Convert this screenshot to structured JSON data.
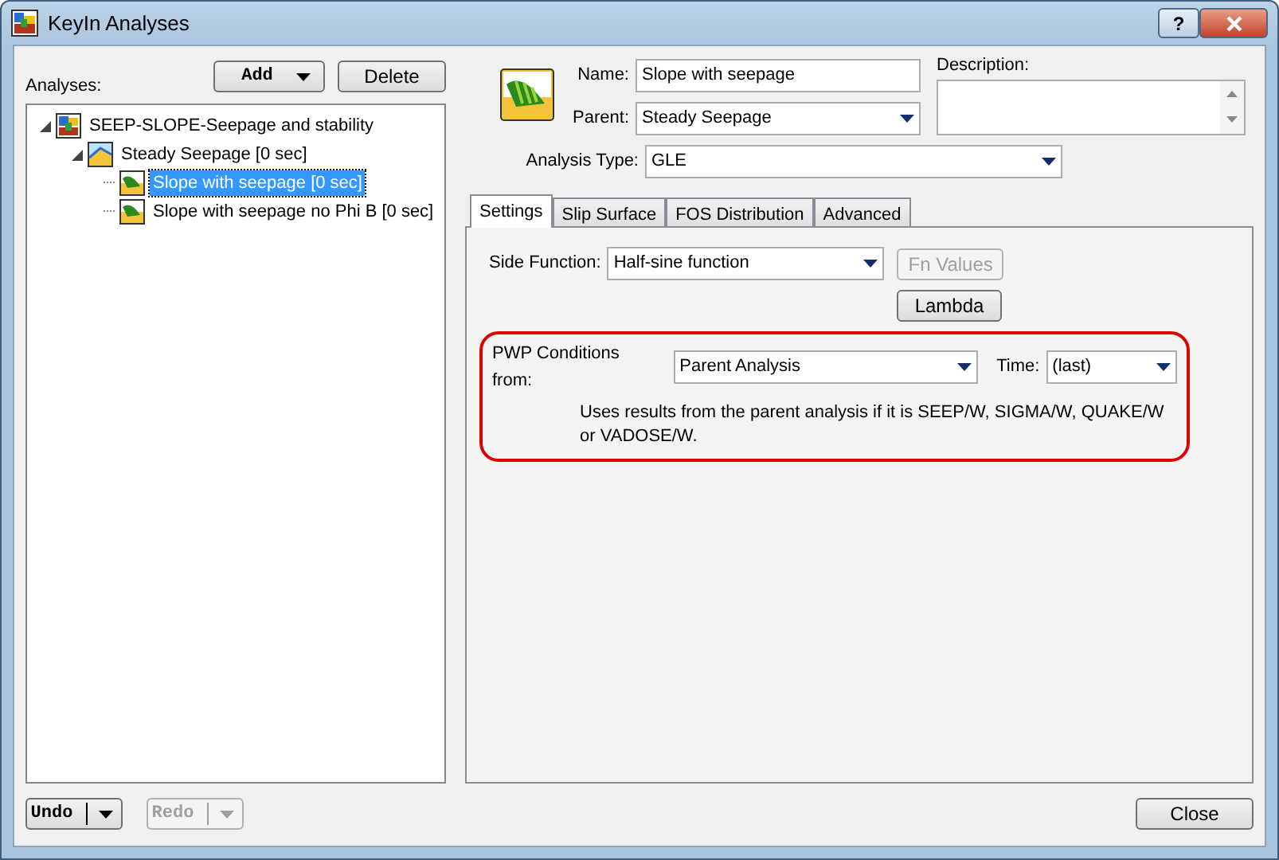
{
  "window": {
    "title": "KeyIn Analyses",
    "help_button": "?"
  },
  "analyses": {
    "label": "Analyses:",
    "add_button": "Add",
    "delete_button": "Delete",
    "tree": [
      {
        "label": "SEEP-SLOPE-Seepage and stability",
        "kind": "project",
        "expanded": true,
        "selected": false,
        "children": [
          {
            "label": "Steady Seepage [0 sec]",
            "kind": "seepage",
            "expanded": true,
            "selected": false,
            "children": [
              {
                "label": "Slope with seepage [0 sec]",
                "kind": "slope",
                "selected": true
              },
              {
                "label": "Slope with seepage no Phi B [0 sec]",
                "kind": "slope",
                "selected": false
              }
            ]
          }
        ]
      }
    ]
  },
  "details": {
    "name_label": "Name:",
    "name_value": "Slope with seepage",
    "parent_label": "Parent:",
    "parent_value": "Steady Seepage",
    "description_label": "Description:",
    "type_label": "Analysis Type:",
    "type_value": "GLE"
  },
  "tabs": [
    {
      "label": "Settings",
      "selected": true
    },
    {
      "label": "Slip Surface",
      "selected": false
    },
    {
      "label": "FOS Distribution",
      "selected": false
    },
    {
      "label": "Advanced",
      "selected": false
    }
  ],
  "settings": {
    "side_function_label": "Side Function:",
    "side_function_value": "Half-sine function",
    "fn_values_button": {
      "label": "Fn Values",
      "disabled": true
    },
    "lambda_button": {
      "label": "Lambda",
      "disabled": false
    },
    "pwp_label": "PWP Conditions from:",
    "pwp_value": "Parent Analysis",
    "time_label": "Time:",
    "time_value": "(last)",
    "note": "Uses results from the parent analysis if it is SEEP/W, SIGMA/W, QUAKE/W or VADOSE/W.",
    "highlighted": true
  },
  "footer": {
    "undo": {
      "label": "Undo",
      "disabled": false
    },
    "redo": {
      "label": "Redo",
      "disabled": true
    },
    "close": "Close"
  }
}
